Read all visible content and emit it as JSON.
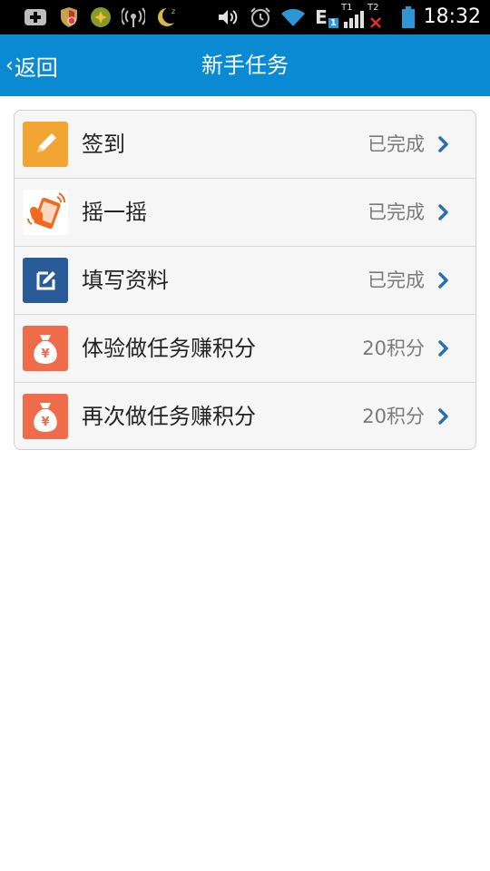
{
  "status_bar": {
    "time": "18:32",
    "network_type": "E",
    "sim1_label": "1",
    "sim1_tag": "T1",
    "sim2_tag": "T2",
    "icons": [
      "add-notification-icon",
      "shield-icon",
      "clover-icon",
      "wifi-hotspot-icon",
      "moon-icon",
      "volume-icon",
      "alarm-icon",
      "wifi-icon",
      "signal-icon",
      "battery-icon"
    ]
  },
  "header": {
    "back_chevron": "‹",
    "back_label": "返回",
    "title": "新手任务",
    "background": "#0a8ad2"
  },
  "tasks": [
    {
      "label": "签到",
      "status": "已完成",
      "icon": "pencil-icon",
      "icon_bg": "#f3a533"
    },
    {
      "label": "摇一摇",
      "status": "已完成",
      "icon": "shake-phone-icon",
      "icon_bg": "#ffffff"
    },
    {
      "label": "填写资料",
      "status": "已完成",
      "icon": "edit-form-icon",
      "icon_bg": "#2a5b99"
    },
    {
      "label": "体验做任务赚积分",
      "status": "20积分",
      "icon": "money-bag-icon",
      "icon_bg": "#f06b4a"
    },
    {
      "label": "再次做任务赚积分",
      "status": "20积分",
      "icon": "money-bag-icon",
      "icon_bg": "#f06b4a"
    }
  ],
  "colors": {
    "chevron": "#2a6fb3",
    "status_text": "#7a7a7a"
  }
}
